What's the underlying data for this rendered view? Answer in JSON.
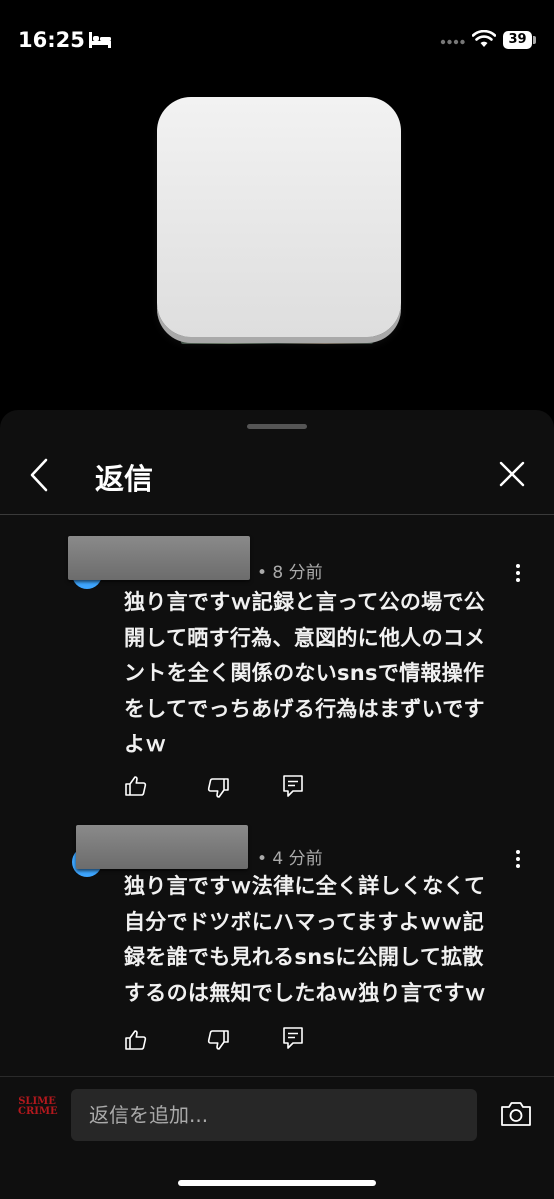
{
  "status_bar": {
    "time": "16:25",
    "battery": "39"
  },
  "sheet": {
    "title": "返信"
  },
  "comments": [
    {
      "time_ago": "• 8 分前",
      "lines": [
        "独り言ですｗ記録と言って公の場で公",
        "開して晒す行為、意図的に他人のコメ",
        "ントを全く関係のないsnsで情報操作",
        "をしてでっちあげる行為はまずいです",
        "よｗ"
      ]
    },
    {
      "time_ago": "• 4 分前",
      "lines": [
        "独り言ですｗ法律に全く詳しくなくて",
        "自分でドツボにハマってますよｗｗ記",
        "録を誰でも見れるsnsに公開して拡散",
        "するのは無知でしたねｗ独り言ですｗ"
      ]
    }
  ],
  "reply_bar": {
    "placeholder": "返信を追加...",
    "avatar_text": "SLIME CRIME"
  },
  "icons": {
    "like": "thumb-up-icon",
    "dislike": "thumb-down-icon",
    "reply": "reply-icon",
    "back": "chevron-left-icon",
    "close": "close-icon",
    "camera": "camera-icon",
    "more": "more-vertical-icon"
  }
}
